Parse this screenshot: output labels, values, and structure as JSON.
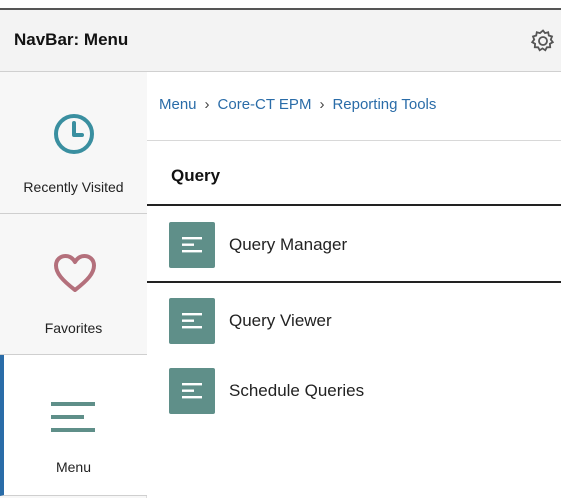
{
  "header": {
    "title": "NavBar: Menu",
    "gear_icon": "gear-icon"
  },
  "sidebar": {
    "items": [
      {
        "label": "Recently Visited",
        "icon": "clock-icon",
        "active": false
      },
      {
        "label": "Favorites",
        "icon": "heart-icon",
        "active": false
      },
      {
        "label": "Menu",
        "icon": "menu-lines-icon",
        "active": true
      }
    ]
  },
  "breadcrumb": {
    "items": [
      "Menu",
      "Core-CT EPM",
      "Reporting Tools"
    ],
    "separator_icon": "chevron-right-icon"
  },
  "main": {
    "group_title": "Query",
    "items": [
      {
        "label": "Query Manager",
        "icon": "list-icon"
      },
      {
        "label": "Query Viewer",
        "icon": "list-icon"
      },
      {
        "label": "Schedule Queries",
        "icon": "list-icon"
      }
    ]
  },
  "colors": {
    "accent": "#2a6ca8",
    "clock": "#3a8fa0",
    "heart": "#b4707c",
    "tile": "#5f8f89"
  }
}
